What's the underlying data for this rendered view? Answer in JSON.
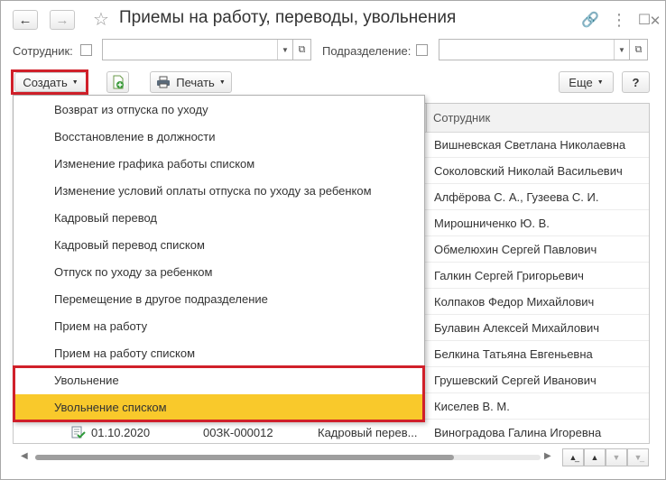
{
  "window": {
    "title": "Приемы на работу, переводы, увольнения"
  },
  "filters": {
    "employee_label": "Сотрудник:",
    "department_label": "Подразделение:"
  },
  "toolbar": {
    "create_label": "Создать",
    "print_label": "Печать",
    "more_label": "Еще",
    "help_label": "?"
  },
  "table": {
    "column_employee": "Сотрудник",
    "rows": [
      {
        "employee": "Вишневская Светлана Николаевна"
      },
      {
        "employee": "Соколовский Николай Васильевич"
      },
      {
        "employee": "Алфёрова С. А., Гузеева С. И."
      },
      {
        "employee": "Мирошниченко Ю. В."
      },
      {
        "employee": "Обмелюхин Сергей Павлович"
      },
      {
        "employee": "Галкин Сергей Григорьевич"
      },
      {
        "employee": "Колпаков Федор Михайлович"
      },
      {
        "employee": "Булавин Алексей Михайлович"
      },
      {
        "employee": "Белкина Татьяна Евгеньевна"
      },
      {
        "employee": "Грушевский Сергей Иванович"
      },
      {
        "employee": "Киселев В. М."
      },
      {
        "employee": "Виноградова Галина Игоревна",
        "date": "01.10.2020",
        "number": "00ЗК-000012",
        "doc_type": "Кадровый перев..."
      }
    ]
  },
  "menu": {
    "items": [
      "Возврат из отпуска по уходу",
      "Восстановление в должности",
      "Изменение графика работы списком",
      "Изменение условий оплаты отпуска по уходу за ребенком",
      "Кадровый перевод",
      "Кадровый перевод списком",
      "Отпуск по уходу за ребенком",
      "Перемещение в другое подразделение",
      "Прием на работу",
      "Прием на работу списком",
      "Увольнение",
      "Увольнение списком"
    ],
    "selected_index": 11
  },
  "colors": {
    "highlight": "#f9c92b",
    "callout": "#d0202a"
  }
}
